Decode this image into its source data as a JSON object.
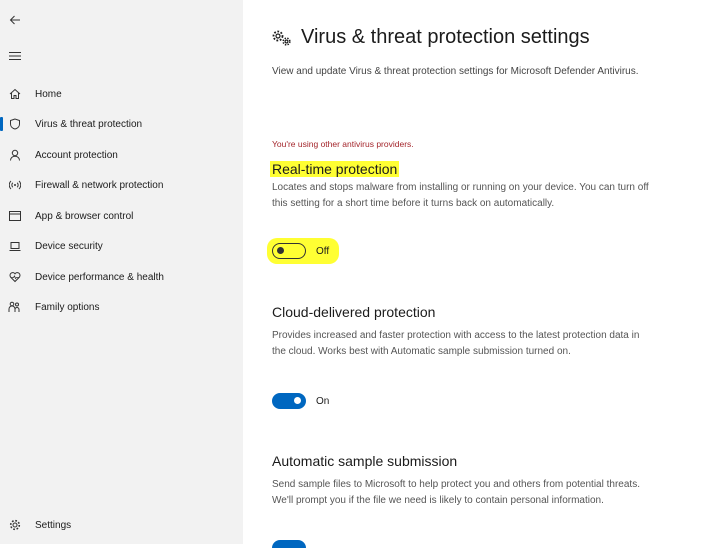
{
  "sidebar": {
    "back_icon": "back-arrow-icon",
    "menu_icon": "hamburger-menu-icon",
    "items": [
      {
        "label": "Home",
        "icon": "home-icon"
      },
      {
        "label": "Virus & threat protection",
        "icon": "shield-icon"
      },
      {
        "label": "Account protection",
        "icon": "person-icon"
      },
      {
        "label": "Firewall & network protection",
        "icon": "wifi-signal-icon"
      },
      {
        "label": "App & browser control",
        "icon": "browser-window-icon"
      },
      {
        "label": "Device security",
        "icon": "laptop-icon"
      },
      {
        "label": "Device performance & health",
        "icon": "heart-icon"
      },
      {
        "label": "Family options",
        "icon": "family-icon"
      }
    ],
    "settings": {
      "label": "Settings",
      "icon": "gear-icon"
    }
  },
  "main": {
    "title": "Virus & threat protection settings",
    "title_icon": "gears-icon",
    "subtitle": "View and update Virus & threat protection settings for Microsoft Defender Antivirus.",
    "warning": "You're using other antivirus providers.",
    "sections": [
      {
        "title": "Real-time protection",
        "description": "Locates and stops malware from installing or running on your device. You can turn off this setting for a short time before it turns back on automatically.",
        "toggle_state": "Off",
        "highlighted": true
      },
      {
        "title": "Cloud-delivered protection",
        "description": "Provides increased and faster protection with access to the latest protection data in the cloud. Works best with Automatic sample submission turned on.",
        "toggle_state": "On"
      },
      {
        "title": "Automatic sample submission",
        "description": "Send sample files to Microsoft to help protect you and others from potential threats. We'll prompt you if the file we need is likely to contain personal information."
      }
    ]
  },
  "colors": {
    "accent": "#0067c0",
    "warning": "#a4262c",
    "highlight": "#ffff33",
    "sidebar_bg": "#f2f2f2"
  }
}
